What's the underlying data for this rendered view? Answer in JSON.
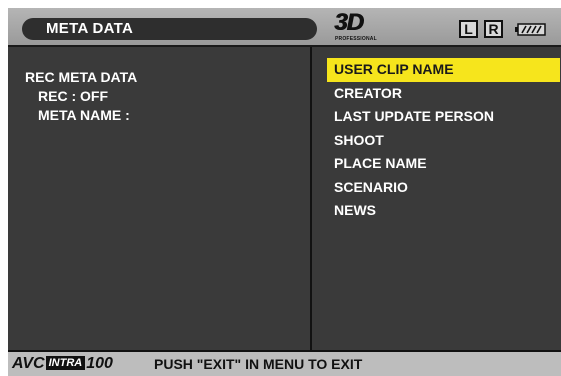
{
  "header": {
    "title": "META DATA",
    "logo_3d": "3D",
    "logo_sub": "PROFESSIONAL",
    "channel_left": "L",
    "channel_right": "R",
    "battery_icon": "battery-icon"
  },
  "left_panel": {
    "heading": "REC META DATA",
    "rec_status": "REC : OFF",
    "meta_name": "META NAME :"
  },
  "menu": {
    "items": [
      {
        "label": "USER CLIP NAME",
        "selected": true
      },
      {
        "label": "CREATOR",
        "selected": false
      },
      {
        "label": "LAST UPDATE PERSON",
        "selected": false
      },
      {
        "label": "SHOOT",
        "selected": false
      },
      {
        "label": "PLACE NAME",
        "selected": false
      },
      {
        "label": "SCENARIO",
        "selected": false
      },
      {
        "label": "NEWS",
        "selected": false
      }
    ]
  },
  "footer": {
    "codec_prefix": "AVC",
    "codec_badge": "INTRA",
    "codec_suffix": "100",
    "message": "PUSH \"EXIT\" IN MENU TO EXIT"
  },
  "colors": {
    "selection": "#f6e51c",
    "screen_bg": "#3a3a3a",
    "bar_bg": "#b5b5b5"
  }
}
